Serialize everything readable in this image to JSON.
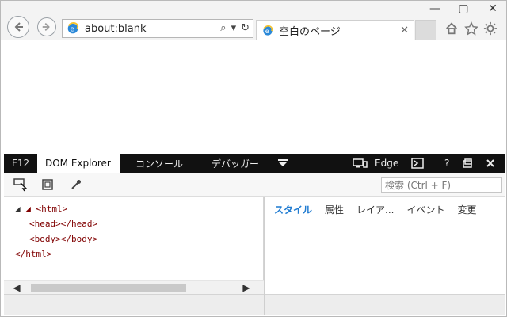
{
  "window": {
    "min_label": "—",
    "max_label": "▢",
    "close_label": "✕"
  },
  "address": {
    "url": "about:blank"
  },
  "tab": {
    "title": "空白のページ",
    "close_label": "✕"
  },
  "devtools": {
    "tabs": [
      {
        "label": "F12"
      },
      {
        "label": "DOM Explorer"
      },
      {
        "label": "コンソール"
      },
      {
        "label": "デバッガー"
      }
    ],
    "engine_label": "Edge",
    "search_placeholder": "検索 (Ctrl + F)",
    "right_tabs": [
      {
        "label": "スタイル"
      },
      {
        "label": "属性"
      },
      {
        "label": "レイア..."
      },
      {
        "label": "イベント"
      },
      {
        "label": "変更"
      }
    ],
    "dom_lines": [
      {
        "text": "◢ <html>"
      },
      {
        "text": "<head></head>"
      },
      {
        "text": "<body></body>"
      },
      {
        "text": "</html>"
      }
    ]
  },
  "accent": "#1f7bd1"
}
